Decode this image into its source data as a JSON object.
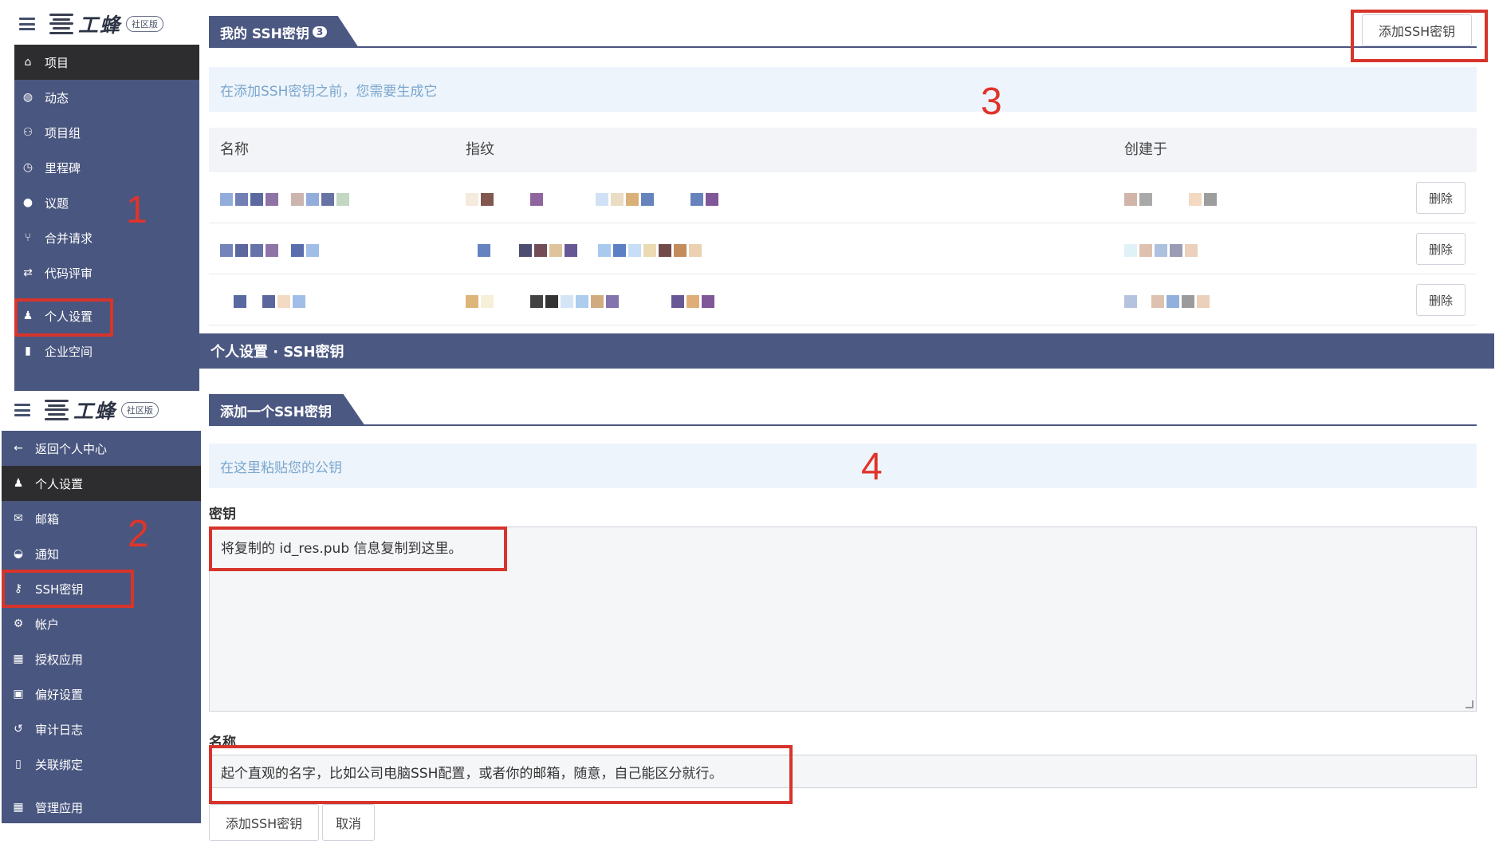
{
  "brand": {
    "name": "工蜂",
    "badge": "社区版"
  },
  "sidebar_top": {
    "items": [
      {
        "icon": "home-icon",
        "glyph": "⌂",
        "label": "项目",
        "active": true
      },
      {
        "icon": "activity-icon",
        "glyph": "◍",
        "label": "动态"
      },
      {
        "icon": "group-icon",
        "glyph": "⚇",
        "label": "项目组"
      },
      {
        "icon": "clock-icon",
        "glyph": "◷",
        "label": "里程碑"
      },
      {
        "icon": "issue-icon",
        "glyph": "●",
        "label": "议题"
      },
      {
        "icon": "merge-icon",
        "glyph": "⑂",
        "label": "合并请求"
      },
      {
        "icon": "code-review-icon",
        "glyph": "⇄",
        "label": "代码评审"
      },
      {
        "icon": "user-icon",
        "glyph": "♟",
        "label": "个人设置"
      },
      {
        "icon": "building-icon",
        "glyph": "▮",
        "label": "企业空间"
      }
    ]
  },
  "sidebar_bottom": {
    "items": [
      {
        "icon": "arrow-left-icon",
        "glyph": "←",
        "label": "返回个人中心"
      },
      {
        "icon": "user-icon",
        "glyph": "♟",
        "label": "个人设置",
        "active": true
      },
      {
        "icon": "mail-icon",
        "glyph": "✉",
        "label": "邮箱"
      },
      {
        "icon": "inbox-icon",
        "glyph": "◒",
        "label": "通知"
      },
      {
        "icon": "key-icon",
        "glyph": "⚷",
        "label": "SSH密钥"
      },
      {
        "icon": "gear-icon",
        "glyph": "⚙",
        "label": "帐户"
      },
      {
        "icon": "grid-icon",
        "glyph": "▦",
        "label": "授权应用"
      },
      {
        "icon": "image-icon",
        "glyph": "▣",
        "label": "偏好设置"
      },
      {
        "icon": "history-icon",
        "glyph": "↺",
        "label": "审计日志"
      },
      {
        "icon": "book-icon",
        "glyph": "▯",
        "label": "关联绑定"
      },
      {
        "icon": "grid-icon",
        "glyph": "▦",
        "label": "管理应用"
      }
    ]
  },
  "steps": [
    "1",
    "2",
    "3",
    "4"
  ],
  "ssh_list": {
    "title": "我的 SSH密钥",
    "count": "3",
    "add_button": "添加SSH密钥",
    "info": "在添加SSH密钥之前，您需要生成它",
    "columns": [
      "名称",
      "指纹",
      "创建于"
    ],
    "delete_label": "删除"
  },
  "banner": "个人设置 · SSH密钥",
  "add_form": {
    "title": "添加一个SSH密钥",
    "info": "在这里粘贴您的公钥",
    "key_label": "密钥",
    "key_value": "将复制的 id_res.pub 信息复制到这里。",
    "name_label": "名称",
    "name_value": "起个直观的名字，比如公司电脑SSH配置，或者你的邮箱，随意，自己能区分就行。",
    "submit": "添加SSH密钥",
    "cancel": "取消"
  },
  "colors": {
    "sidebar": "#49567f",
    "active": "#2d2d2f",
    "highlight": "#d7342c"
  }
}
